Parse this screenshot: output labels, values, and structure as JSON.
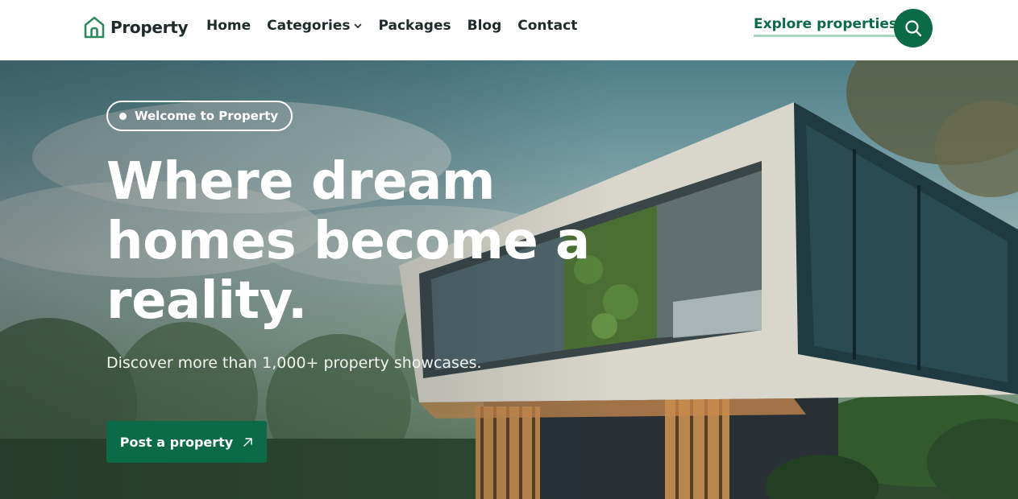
{
  "brand": {
    "name": "Property",
    "logo_icon": "house-icon"
  },
  "nav": {
    "home": "Home",
    "categories": "Categories",
    "packages": "Packages",
    "blog": "Blog",
    "contact": "Contact"
  },
  "header": {
    "explore_label": "Explore properties",
    "search_icon": "search-icon"
  },
  "hero": {
    "badge": "Welcome to Property",
    "headline": "Where dream homes become a reality.",
    "subtext": "Discover more than 1,000+ property showcases.",
    "cta_label": "Post a property",
    "cta_icon": "arrow-up-right-icon"
  },
  "colors": {
    "accent": "#0b6b48",
    "accent_underline": "#a9d6c1",
    "text_dark": "#1f2a2a",
    "white": "#ffffff"
  }
}
